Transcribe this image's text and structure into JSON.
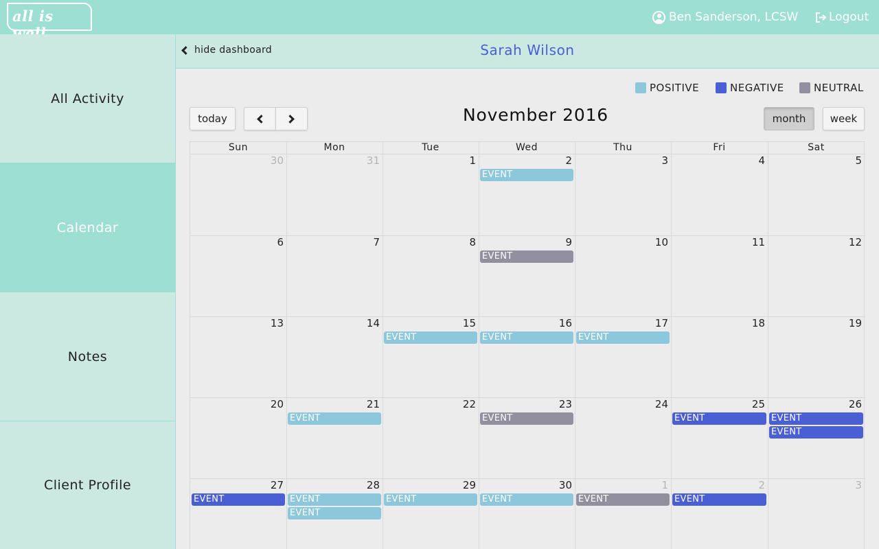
{
  "app": {
    "logo_text": "all is well",
    "user_name": "Ben Sanderson, LCSW",
    "logout_label": "Logout",
    "user_icon": "user-circle-icon",
    "logout_icon": "sign-out-icon"
  },
  "sidebar": {
    "items": [
      {
        "label": "All Activity",
        "active": false
      },
      {
        "label": "Calendar",
        "active": true
      },
      {
        "label": "Notes",
        "active": false
      },
      {
        "label": "Client Profile",
        "active": false
      }
    ]
  },
  "header": {
    "hide_dashboard_label": "hide dashboard",
    "client_name": "Sarah Wilson"
  },
  "legend": [
    {
      "label": "POSITIVE",
      "color": "#8cc7dc"
    },
    {
      "label": "NEGATIVE",
      "color": "#4b5fd4"
    },
    {
      "label": "NEUTRAL",
      "color": "#928f9f"
    }
  ],
  "toolbar": {
    "today_label": "today",
    "title": "November 2016",
    "month_label": "month",
    "week_label": "week",
    "active_view": "month"
  },
  "calendar": {
    "weekdays": [
      "Sun",
      "Mon",
      "Tue",
      "Wed",
      "Thu",
      "Fri",
      "Sat"
    ],
    "weeks": [
      [
        "30",
        "31",
        "1",
        "2",
        "3",
        "4",
        "5"
      ],
      [
        "6",
        "7",
        "8",
        "9",
        "10",
        "11",
        "12"
      ],
      [
        "13",
        "14",
        "15",
        "16",
        "17",
        "18",
        "19"
      ],
      [
        "20",
        "21",
        "22",
        "23",
        "24",
        "25",
        "26"
      ],
      [
        "27",
        "28",
        "29",
        "30",
        "1",
        "2",
        "3"
      ]
    ],
    "other_month": [
      [
        true,
        true,
        false,
        false,
        false,
        false,
        false
      ],
      [
        false,
        false,
        false,
        false,
        false,
        false,
        false
      ],
      [
        false,
        false,
        false,
        false,
        false,
        false,
        false
      ],
      [
        false,
        false,
        false,
        false,
        false,
        false,
        false
      ],
      [
        false,
        false,
        false,
        false,
        true,
        true,
        true
      ]
    ],
    "events": [
      {
        "week": 0,
        "day": 3,
        "slot": 0,
        "label": "EVENT",
        "type": "positive"
      },
      {
        "week": 1,
        "day": 3,
        "slot": 0,
        "label": "EVENT",
        "type": "neutral"
      },
      {
        "week": 2,
        "day": 2,
        "slot": 0,
        "label": "EVENT",
        "type": "positive"
      },
      {
        "week": 2,
        "day": 3,
        "slot": 0,
        "label": "EVENT",
        "type": "positive"
      },
      {
        "week": 2,
        "day": 4,
        "slot": 0,
        "label": "EVENT",
        "type": "positive"
      },
      {
        "week": 3,
        "day": 1,
        "slot": 0,
        "label": "EVENT",
        "type": "positive"
      },
      {
        "week": 3,
        "day": 3,
        "slot": 0,
        "label": "EVENT",
        "type": "neutral"
      },
      {
        "week": 3,
        "day": 5,
        "slot": 0,
        "label": "EVENT",
        "type": "negative"
      },
      {
        "week": 3,
        "day": 6,
        "slot": 0,
        "label": "EVENT",
        "type": "negative"
      },
      {
        "week": 3,
        "day": 6,
        "slot": 1,
        "label": "EVENT",
        "type": "negative"
      },
      {
        "week": 4,
        "day": 0,
        "slot": 0,
        "label": "EVENT",
        "type": "negative"
      },
      {
        "week": 4,
        "day": 1,
        "slot": 0,
        "label": "EVENT",
        "type": "positive"
      },
      {
        "week": 4,
        "day": 1,
        "slot": 1,
        "label": "EVENT",
        "type": "positive"
      },
      {
        "week": 4,
        "day": 2,
        "slot": 0,
        "label": "EVENT",
        "type": "positive"
      },
      {
        "week": 4,
        "day": 3,
        "slot": 0,
        "label": "EVENT",
        "type": "positive"
      },
      {
        "week": 4,
        "day": 4,
        "slot": 0,
        "label": "EVENT",
        "type": "neutral"
      },
      {
        "week": 4,
        "day": 5,
        "slot": 0,
        "label": "EVENT",
        "type": "negative"
      }
    ],
    "colors": {
      "positive": "#8cc7dc",
      "negative": "#4b5fd4",
      "neutral": "#928f9f"
    }
  }
}
